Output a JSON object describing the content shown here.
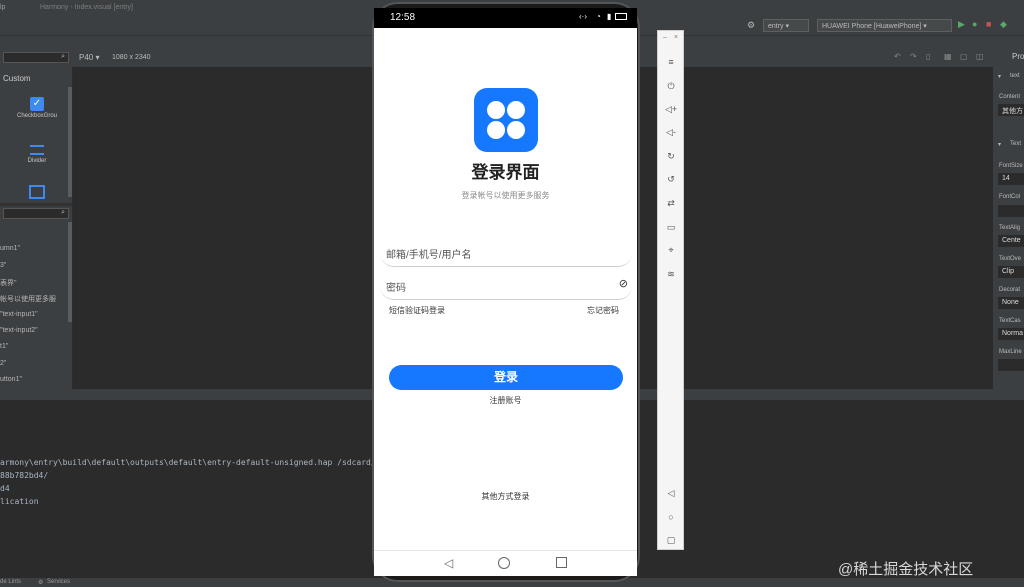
{
  "ide": {
    "titlebar_left": "lp",
    "title": "Harmony - Index.visual [entry]",
    "device_preset": "P40",
    "resolution": "1080 x 2340",
    "run_config": "entry",
    "device_select": "HUAWEI Phone [HuaweiPhone]",
    "right_tab": "Pro",
    "components_header": "Custom",
    "components": [
      "CheckboxGrou",
      "Divider"
    ],
    "tree_items": [
      "umn1\"",
      "3\"",
      "表界\"",
      "帐号以使用更多服",
      "\"text-input1\"",
      "\"text-input2\"",
      "t1\"",
      "2\"",
      "utton1\""
    ],
    "properties": [
      {
        "label": "text",
        "value": ""
      },
      {
        "label": "Content",
        "value": "其他方"
      },
      {
        "label": "Text",
        "value": ""
      },
      {
        "label": "FontSize",
        "value": "14"
      },
      {
        "label": "FontCol",
        "value": ""
      },
      {
        "label": "TextAlig",
        "value": "Cente"
      },
      {
        "label": "TextOve",
        "value": "Clip"
      },
      {
        "label": "Decorat",
        "value": "None"
      },
      {
        "label": "TextCas",
        "value": "Norma"
      },
      {
        "label": "MaxLine",
        "value": ""
      }
    ],
    "console_lines": [
      "armony\\entry\\build\\default\\outputs\\default\\entry-default-unsigned.hap /sdcard/4b",
      "88b782bd4/",
      "d4",
      "lication"
    ],
    "status_left": "de Lints",
    "status_services": "Services"
  },
  "phone": {
    "time": "12:58",
    "app_title": "登录界面",
    "subtitle": "登录帐号以使用更多服务",
    "account_placeholder": "邮箱/手机号/用户名",
    "password_placeholder": "密码",
    "sms_login": "短信验证码登录",
    "forgot_password": "忘记密码",
    "login_button": "登录",
    "register": "注册账号",
    "other_login": "其他方式登录",
    "accent_color": "#1677ff"
  },
  "watermark": "@稀土掘金技术社区"
}
